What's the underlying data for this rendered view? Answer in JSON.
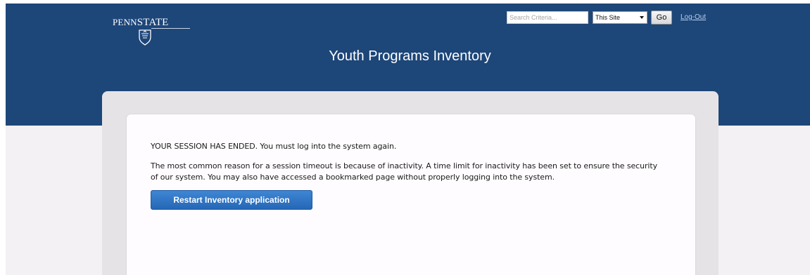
{
  "header": {
    "logo_text_prefix": "PENN",
    "logo_text_suffix": "STATE",
    "title": "Youth Programs Inventory"
  },
  "search": {
    "placeholder": "Search Criteria...",
    "scope_selected": "This Site",
    "go_label": "Go"
  },
  "logout_label": "Log-Out",
  "content": {
    "session_notice": "YOUR SESSION HAS ENDED. You must log into the system again.",
    "reason_text": "The most common reason for a session timeout is because of inactivity. A time limit for inactivity has been set to ensure the security of our system. You may also have accessed a bookmarked page without properly logging into the system.",
    "restart_label": "Restart Inventory application"
  },
  "colors": {
    "header_blue": "#1d4679",
    "button_blue": "#2f76c6",
    "logout_link": "#b9cdeb"
  },
  "icons": [
    "penn-state-shield-icon",
    "dropdown-arrow-icon"
  ]
}
